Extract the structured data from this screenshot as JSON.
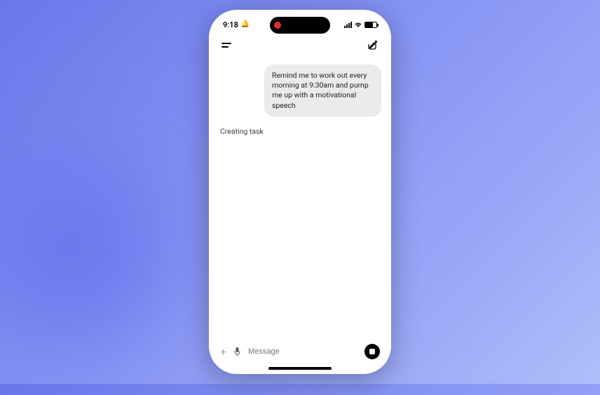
{
  "statusbar": {
    "time": "9:18",
    "bell_glyph": "🔔",
    "wifi_glyph": "📶"
  },
  "chat": {
    "user_message": "Remind me to work out every morning at 9:30am and pump me up with a motivational speech",
    "assistant_status": "Creating task"
  },
  "input": {
    "placeholder": "Message",
    "plus_glyph": "+",
    "mic_glyph": "🎤"
  }
}
